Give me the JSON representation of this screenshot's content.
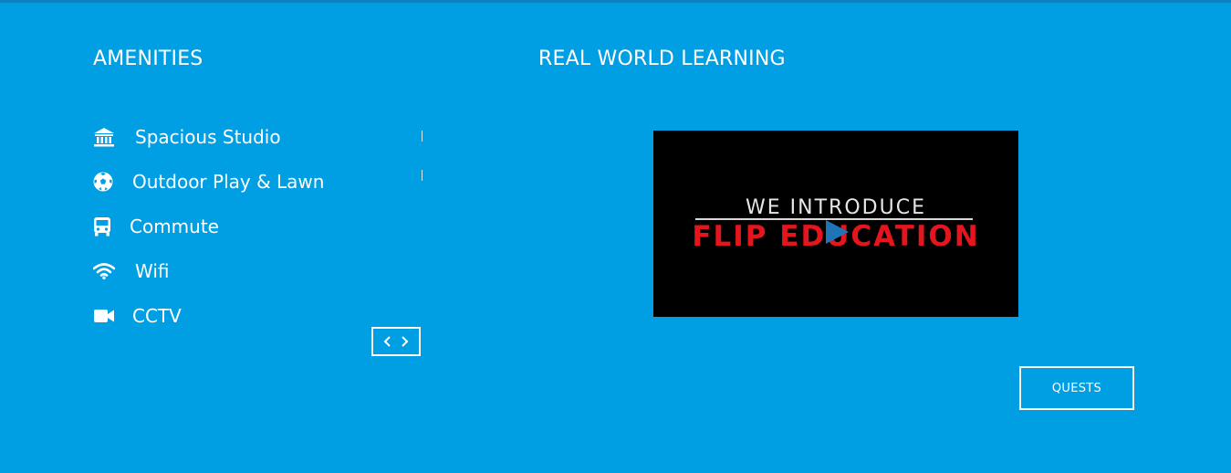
{
  "amenities": {
    "title": "AMENITIES",
    "items": [
      {
        "label": "Spacious Studio",
        "icon": "bank-icon"
      },
      {
        "label": "Outdoor Play & Lawn",
        "icon": "soccer-ball-icon"
      },
      {
        "label": "Commute",
        "icon": "bus-icon"
      },
      {
        "label": "Wifi",
        "icon": "wifi-icon"
      },
      {
        "label": "CCTV",
        "icon": "video-camera-icon"
      }
    ],
    "carousel_nav": {
      "prev_icon": "chevron-left-icon",
      "next_icon": "chevron-right-icon"
    }
  },
  "learning": {
    "title": "REAL WORLD LEARNING",
    "video": {
      "line1": "WE INTRODUCE",
      "line2": "FLIP EDUCATION",
      "play_icon": "play-icon"
    },
    "button_label": "QUESTS"
  },
  "colors": {
    "background": "#009fe3",
    "text": "#ffffff",
    "video_background": "#000000",
    "video_accent": "#e4151c",
    "play_icon": "#1f74b5"
  }
}
